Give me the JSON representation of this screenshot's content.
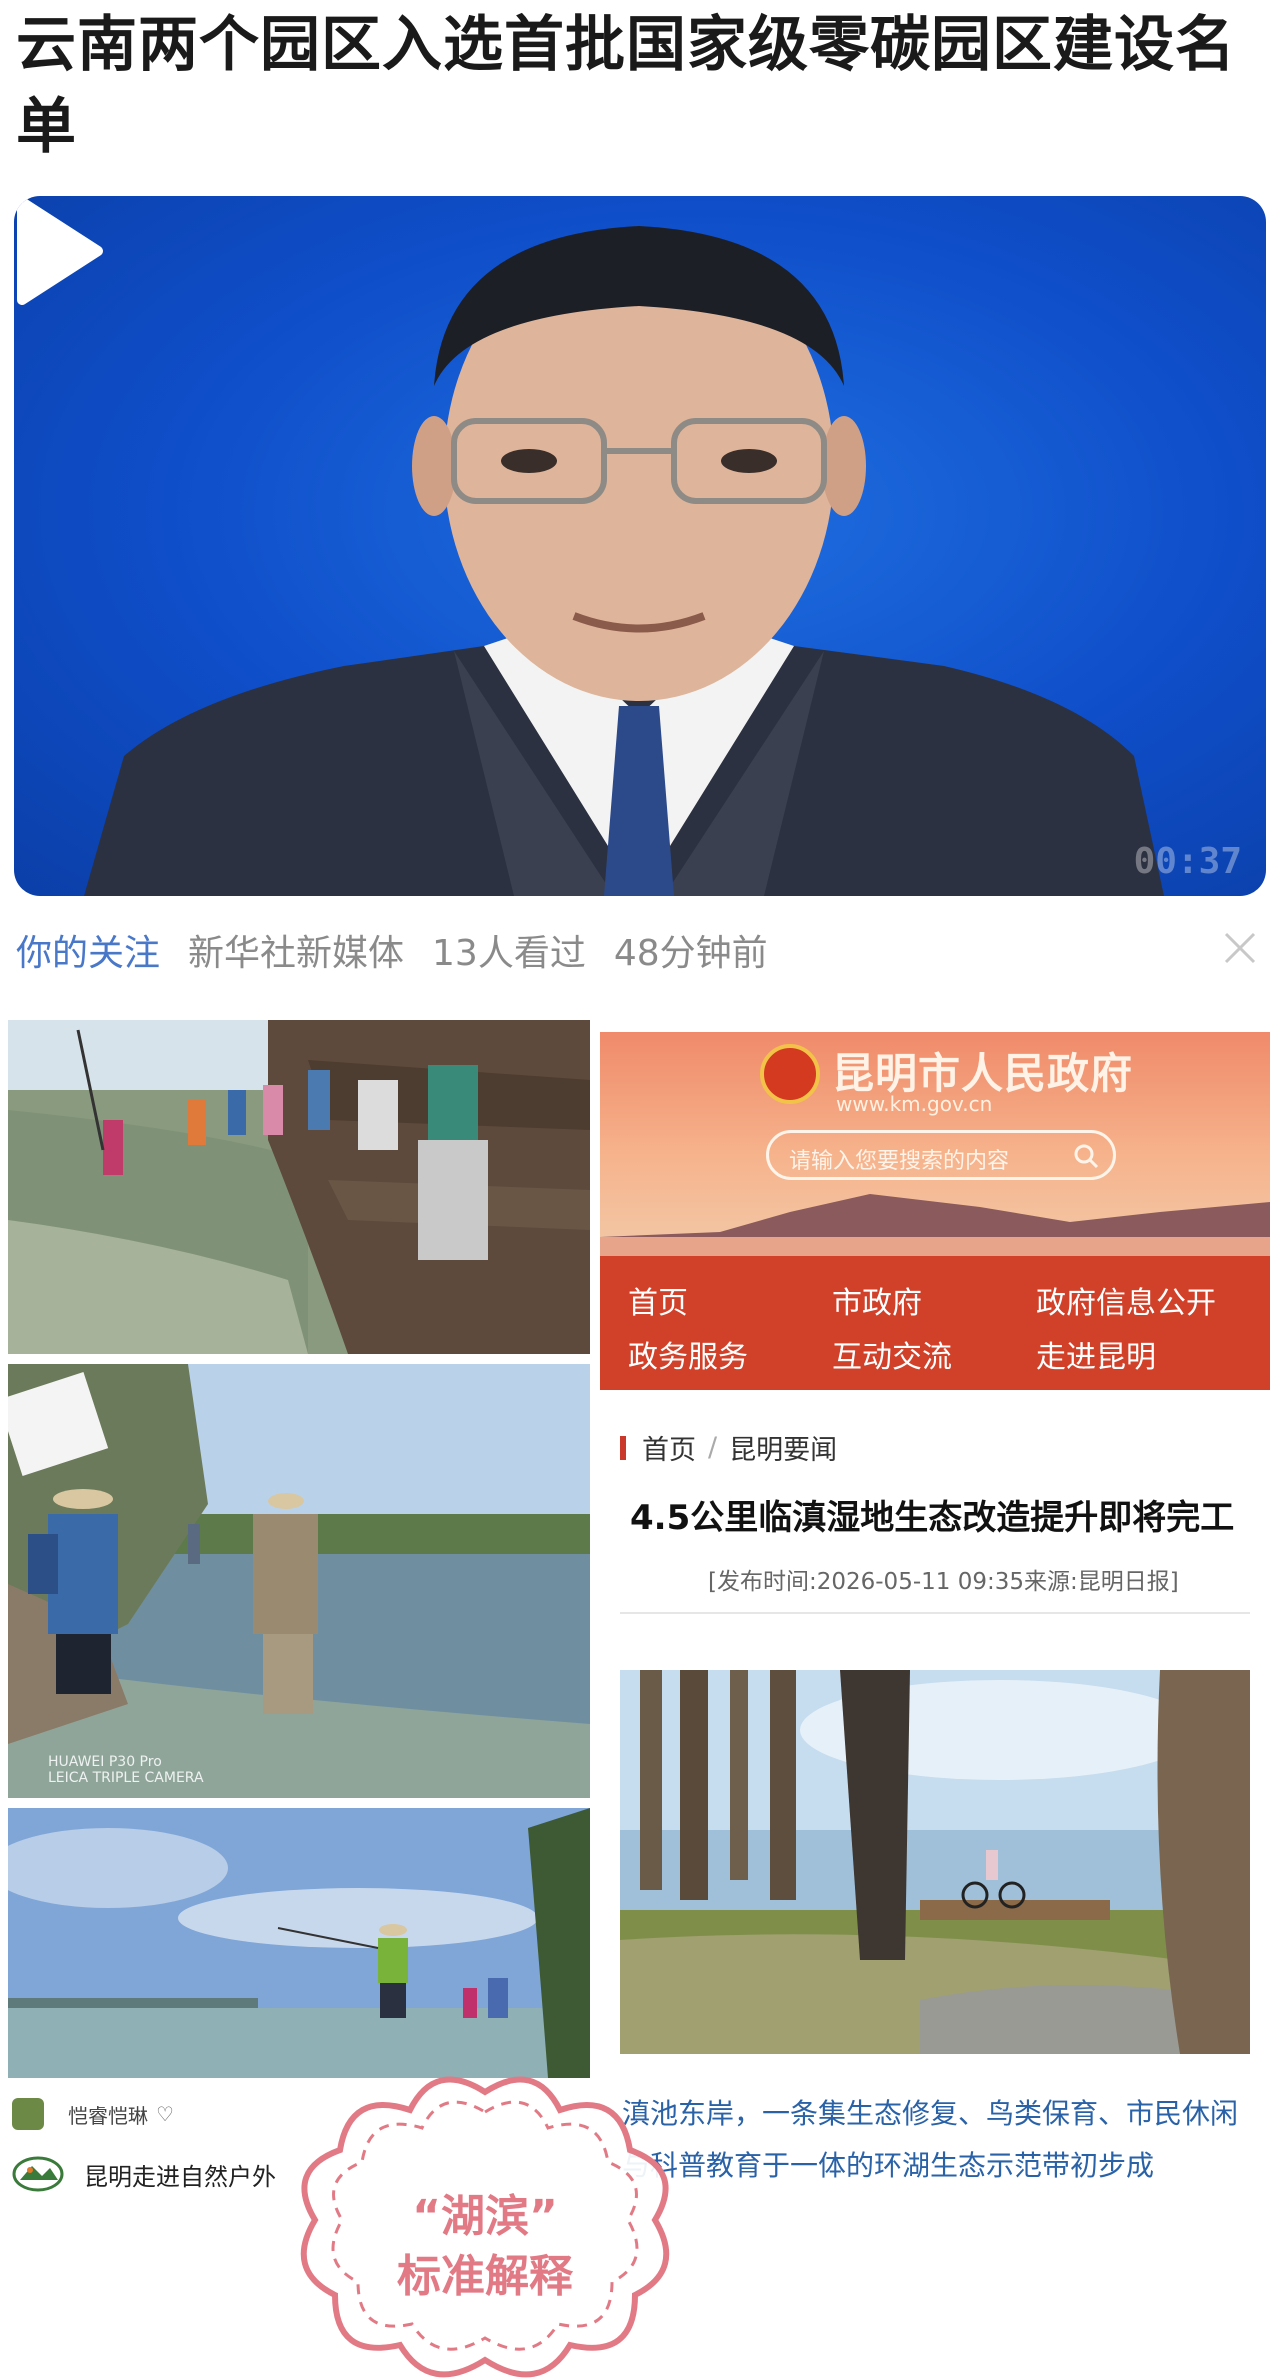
{
  "headline": "云南两个园区入选首批国家级零碳园区建设名单",
  "video": {
    "duration": "00:37"
  },
  "meta": {
    "follow_label": "你的关注",
    "source": "新华社新媒体",
    "views": "13人看过",
    "time": "48分钟前"
  },
  "photo2_caption": [
    "HUAWEI P30 Pro",
    "LEICA TRIPLE CAMERA"
  ],
  "gov_site": {
    "title": "昆明市人民政府",
    "url": "www.km.gov.cn",
    "search_placeholder": "请输入您要搜索的内容",
    "nav": [
      "首页",
      "市政府",
      "政府信息公开",
      "政务服务",
      "互动交流",
      "走进昆明"
    ]
  },
  "breadcrumb": {
    "home": "首页",
    "section": "昆明要闻"
  },
  "article": {
    "title": "4.5公里临滇湿地生态改造提升即将完工",
    "date_line": "[发布时间:2026-05-11 09:35来源:昆明日报]",
    "excerpt": "滇池东岸，一条集生态修复、鸟类保育、市民休闲与科普教育于一体的环湖生态示范带初步成"
  },
  "users": [
    {
      "name": "恺睿恺琳",
      "icon": "heart-icon"
    },
    {
      "name": "昆明走进自然户外"
    }
  ],
  "stamp": {
    "line1": "“湖滨”",
    "line2": "标准解释"
  },
  "colors": {
    "follow": "#4a78c9",
    "gov_nav": "#d1412a",
    "excerpt": "#2a62a8",
    "stamp": "#e27a86"
  }
}
